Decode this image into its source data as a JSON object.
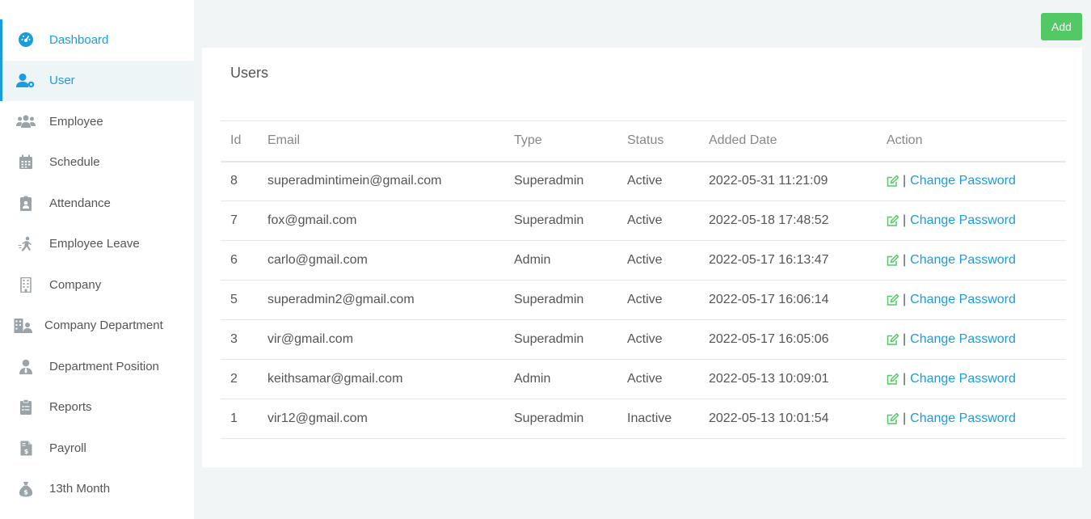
{
  "sidebar": {
    "items": [
      {
        "label": "Dashboard",
        "icon": "dashboard-icon"
      },
      {
        "label": "User",
        "icon": "user-gear-icon"
      },
      {
        "label": "Employee",
        "icon": "users-icon"
      },
      {
        "label": "Schedule",
        "icon": "calendar-icon"
      },
      {
        "label": "Attendance",
        "icon": "id-badge-icon"
      },
      {
        "label": "Employee Leave",
        "icon": "person-walking-icon"
      },
      {
        "label": "Company",
        "icon": "building-icon"
      },
      {
        "label": "Company Department",
        "icon": "city-buildings-icon"
      },
      {
        "label": "Department Position",
        "icon": "person-tie-icon"
      },
      {
        "label": "Reports",
        "icon": "clipboard-icon"
      },
      {
        "label": "Payroll",
        "icon": "invoice-dollar-icon"
      },
      {
        "label": "13th Month",
        "icon": "money-bag-icon"
      }
    ],
    "active": "User"
  },
  "toolbar": {
    "add_label": "Add"
  },
  "card": {
    "title": "Users"
  },
  "table": {
    "headers": {
      "id": "Id",
      "email": "Email",
      "type": "Type",
      "status": "Status",
      "date": "Added Date",
      "action": "Action"
    },
    "separator": "|",
    "action_label": "Change Password",
    "rows": [
      {
        "id": "8",
        "email": "superadmintimein@gmail.com",
        "type": "Superadmin",
        "status": "Active",
        "date": "2022-05-31 11:21:09"
      },
      {
        "id": "7",
        "email": "fox@gmail.com",
        "type": "Superadmin",
        "status": "Active",
        "date": "2022-05-18 17:48:52"
      },
      {
        "id": "6",
        "email": "carlo@gmail.com",
        "type": "Admin",
        "status": "Active",
        "date": "2022-05-17 16:13:47"
      },
      {
        "id": "5",
        "email": "superadmin2@gmail.com",
        "type": "Superadmin",
        "status": "Active",
        "date": "2022-05-17 16:06:14"
      },
      {
        "id": "3",
        "email": "vir@gmail.com",
        "type": "Superadmin",
        "status": "Active",
        "date": "2022-05-17 16:05:06"
      },
      {
        "id": "2",
        "email": "keithsamar@gmail.com",
        "type": "Admin",
        "status": "Active",
        "date": "2022-05-13 10:09:01"
      },
      {
        "id": "1",
        "email": "vir12@gmail.com",
        "type": "Superadmin",
        "status": "Inactive",
        "date": "2022-05-13 10:01:54"
      }
    ]
  },
  "colors": {
    "accent": "#1a9ce0",
    "add_button": "#52c965",
    "edit_icon": "#52c965",
    "nav_icon": "#9aa3a8"
  }
}
